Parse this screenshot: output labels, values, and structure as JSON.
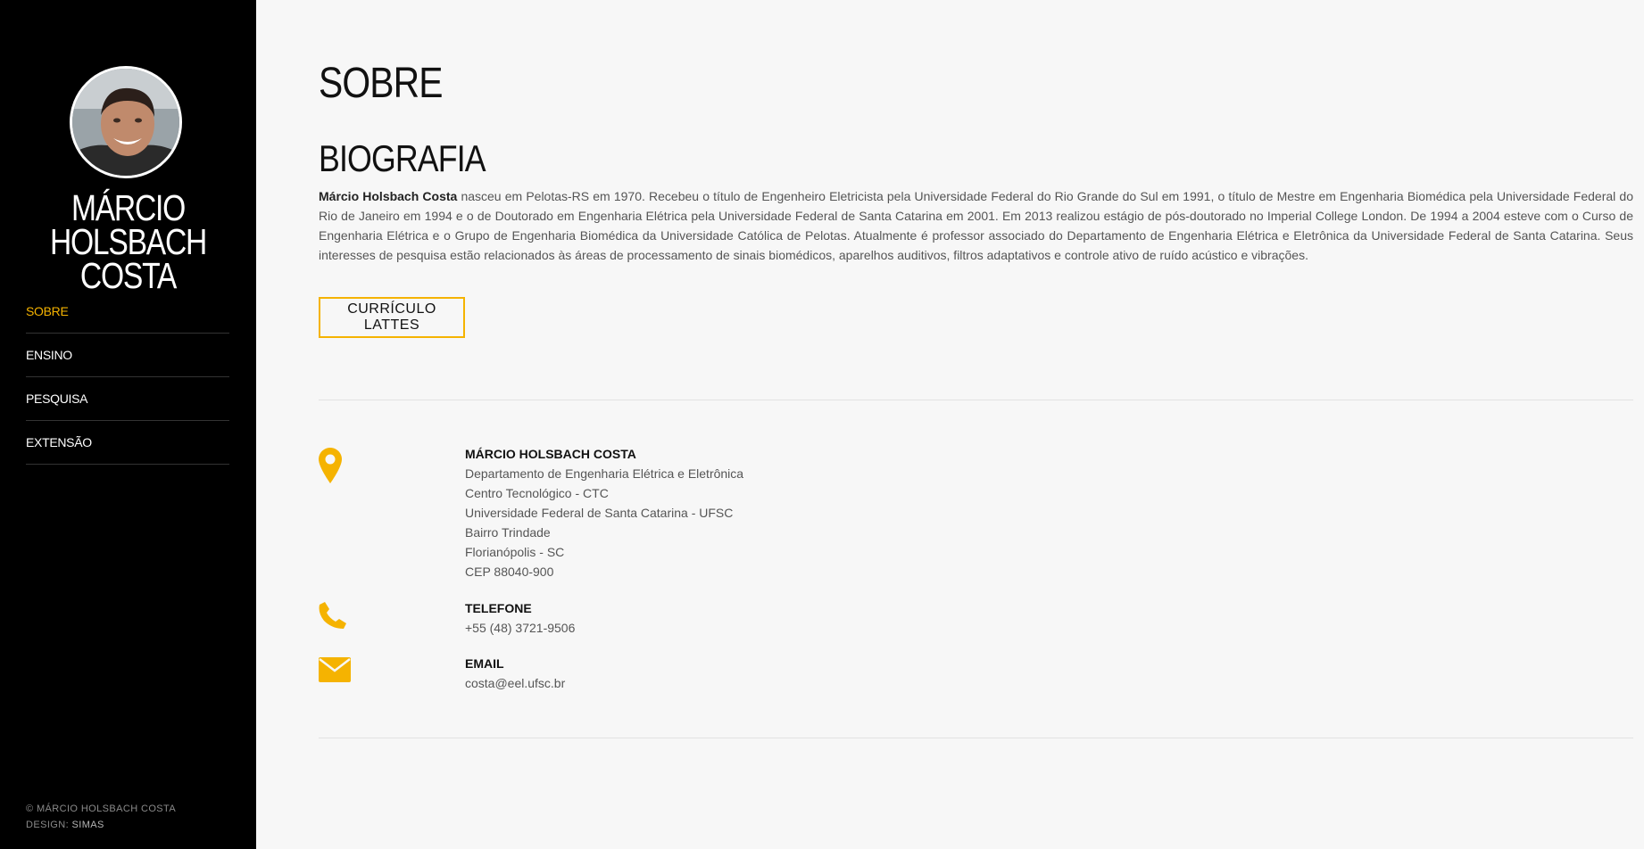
{
  "sidebar": {
    "name": "MÁRCIO HOLSBACH COSTA",
    "nav": [
      {
        "label": "SOBRE",
        "active": true
      },
      {
        "label": "ENSINO",
        "active": false
      },
      {
        "label": "PESQUISA",
        "active": false
      },
      {
        "label": "EXTENSÃO",
        "active": false
      }
    ],
    "footer": {
      "copyright": "© MÁRCIO HOLSBACH COSTA",
      "design_prefix": "DESIGN: ",
      "design_name": "SIMAS"
    }
  },
  "main": {
    "page_title": "SOBRE",
    "section_title": "BIOGRAFIA",
    "bio_name": "Márcio Holsbach Costa",
    "bio_text": " nasceu em Pelotas-RS em 1970. Recebeu o título de Engenheiro Eletricista pela Universidade Federal do Rio Grande do Sul em 1991, o título de Mestre em Engenharia Biomédica pela Universidade Federal do Rio de Janeiro em 1994 e o de Doutorado em Engenharia Elétrica pela Universidade Federal de Santa Catarina em 2001. Em 2013 realizou estágio de pós-doutorado no Imperial College London. De 1994 a 2004 esteve com o Curso de Engenharia Elétrica e o Grupo de Engenharia Biomédica da Universidade Católica de Pelotas. Atualmente é professor associado do Departamento de Engenharia Elétrica e Eletrônica da Universidade Federal de Santa Catarina. Seus interesses de pesquisa estão relacionados às áreas de processamento de sinais biomédicos, aparelhos auditivos, filtros adaptativos e controle ativo de ruído acústico e vibrações.",
    "lattes_button": "CURRÍCULO LATTES"
  },
  "contact": {
    "address": {
      "label": "MÁRCIO HOLSBACH COSTA",
      "lines": [
        "Departamento de Engenharia Elétrica e Eletrônica",
        "Centro Tecnológico - CTC",
        "Universidade Federal de Santa Catarina - UFSC",
        "Bairro Trindade",
        "Florianópolis - SC",
        "CEP 88040-900"
      ]
    },
    "phone": {
      "label": "TELEFONE",
      "value": "+55 (48) 3721-9506"
    },
    "email": {
      "label": "EMAIL",
      "value": "costa@eel.ufsc.br"
    }
  },
  "colors": {
    "accent": "#f5b301",
    "sidebar_bg": "#000000",
    "page_bg": "#f7f7f7"
  },
  "icons": {
    "address": "map-marker-icon",
    "phone": "phone-icon",
    "email": "envelope-icon"
  }
}
